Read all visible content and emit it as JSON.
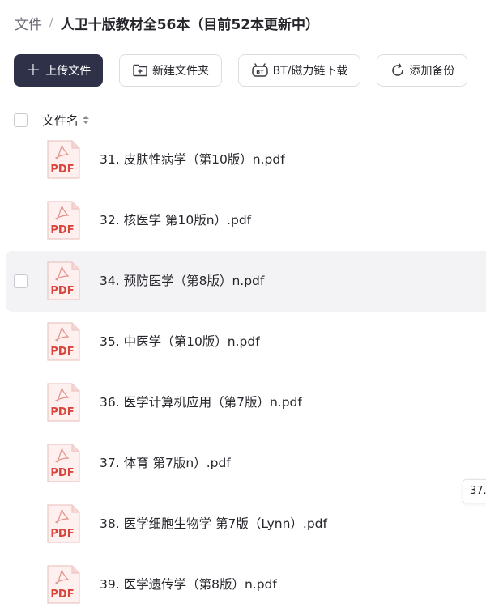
{
  "breadcrumb": {
    "root": "文件",
    "separator": "/",
    "current": "人卫十版教材全56本（目前52本更新中）"
  },
  "toolbar": {
    "upload": "上传文件",
    "new_folder": "新建文件夹",
    "bt_download": "BT/磁力链下载",
    "add_backup": "添加备份"
  },
  "list_header": {
    "filename_label": "文件名"
  },
  "file_icon_text": "PDF",
  "files": [
    {
      "name": "31. 皮肤性病学（第10版）n.pdf"
    },
    {
      "name": "32. 核医学 第10版n）.pdf"
    },
    {
      "name": "34. 预防医学（第8版）n.pdf"
    },
    {
      "name": "35. 中医学（第10版）n.pdf"
    },
    {
      "name": "36. 医学计算机应用（第7版）n.pdf"
    },
    {
      "name": "37. 体育 第7版n）.pdf"
    },
    {
      "name": "38. 医学细胞生物学 第7版（Lynn）.pdf"
    },
    {
      "name": "39. 医学遗传学（第8版）n.pdf"
    }
  ],
  "tooltip": {
    "text": "37."
  },
  "colors": {
    "primary_button": "#2e3147",
    "pdf_red": "#d9453c",
    "hover_row": "#f3f3f5"
  }
}
